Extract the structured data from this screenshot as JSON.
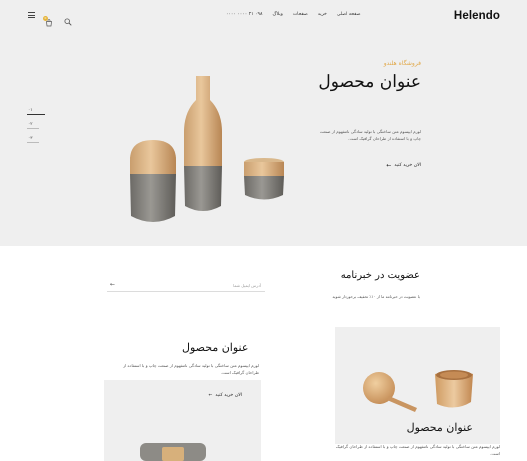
{
  "header": {
    "logo": "Helendo",
    "nav": [
      "صفحه اصلی",
      "خرید",
      "صفحات",
      "وبلاگ"
    ],
    "phone": "۰۹۸ ۲۱ ۰۰۰۰ ۰۰۰۰",
    "cart_count": "0",
    "icons": [
      "search-icon",
      "cart-icon",
      "menu-icon"
    ],
    "accent_color": "#e6b53b"
  },
  "hero": {
    "subtitle": "فروشگاه هلندو",
    "title": "عنوان محصول",
    "description": "لورم ایپسوم متن ساختگی با تولید سادگی نامفهوم از صنعت چاپ و با استفاده از طراحان گرافیک است.",
    "cta": "الان خرید کنید",
    "slides": [
      "۰۱",
      "۰۲",
      "۰۳"
    ],
    "active_slide": 0
  },
  "newsletter": {
    "title": "عضویت در خبرنامه",
    "description": "با عضویت در خبرنامه ما از ۱۰٪ تخفیف برخوردار شوید",
    "placeholder": "آدرس ایمیل شما"
  },
  "products": [
    {
      "title": "عنوان محصول",
      "description": "لورم ایپسوم متن ساختگی با تولید سادگی نامفهوم از صنعت چاپ و با استفاده از طراحان گرافیک است.",
      "cta": "الان خرید کنید"
    },
    {
      "title": "عنوان محصول",
      "description": "لورم ایپسوم متن ساختگی با تولید سادگی نامفهوم از صنعت چاپ و با استفاده از طراحان گرافیک است."
    }
  ]
}
